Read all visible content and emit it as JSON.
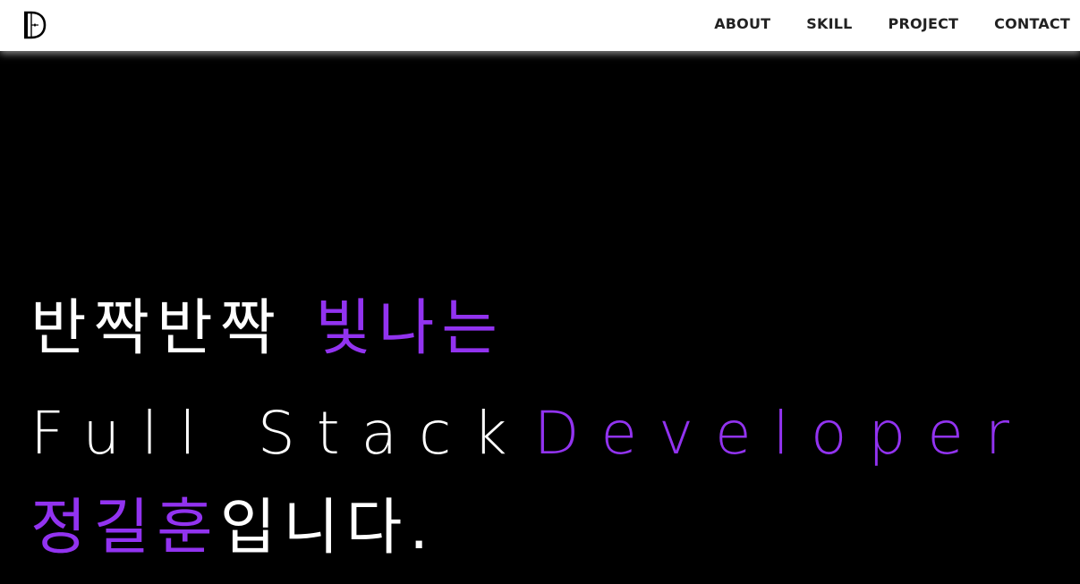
{
  "colors": {
    "accent": "#9233f0",
    "text_light": "#ffffff",
    "background": "#000000",
    "nav_background": "#ffffff",
    "nav_text": "#222222"
  },
  "header": {
    "logo": "D-monogram-logo",
    "nav": [
      {
        "label": "ABOUT"
      },
      {
        "label": "SKILL"
      },
      {
        "label": "PROJECT"
      },
      {
        "label": "CONTACT"
      }
    ]
  },
  "hero": {
    "line1": {
      "white": "반짝반짝",
      "purple": "빛나는"
    },
    "line2": {
      "white": "Full Stack",
      "purple": "Developer"
    },
    "line3": {
      "purple": "정길훈",
      "white": "입니다."
    }
  }
}
